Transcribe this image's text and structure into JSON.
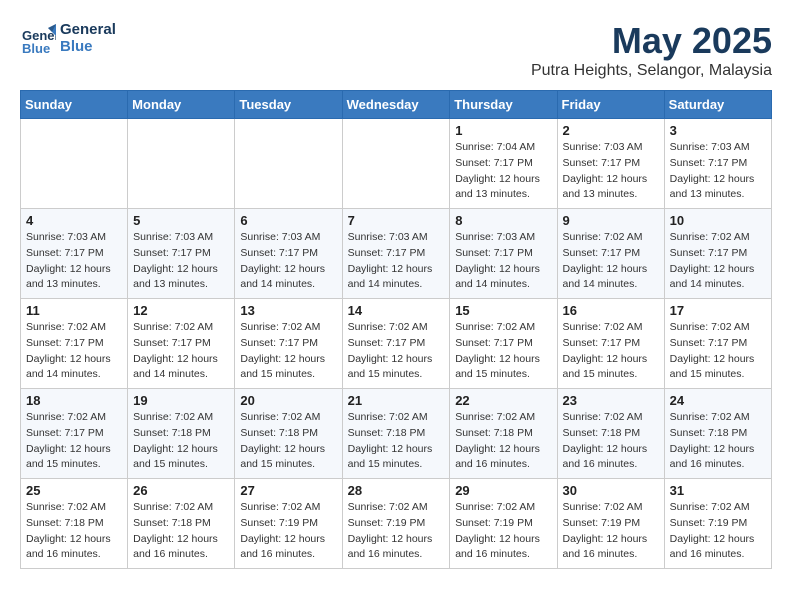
{
  "logo": {
    "line1": "General",
    "line2": "Blue"
  },
  "title": "May 2025",
  "subtitle": "Putra Heights, Selangor, Malaysia",
  "weekdays": [
    "Sunday",
    "Monday",
    "Tuesday",
    "Wednesday",
    "Thursday",
    "Friday",
    "Saturday"
  ],
  "weeks": [
    [
      {
        "day": "",
        "info": ""
      },
      {
        "day": "",
        "info": ""
      },
      {
        "day": "",
        "info": ""
      },
      {
        "day": "",
        "info": ""
      },
      {
        "day": "1",
        "info": "Sunrise: 7:04 AM\nSunset: 7:17 PM\nDaylight: 12 hours\nand 13 minutes."
      },
      {
        "day": "2",
        "info": "Sunrise: 7:03 AM\nSunset: 7:17 PM\nDaylight: 12 hours\nand 13 minutes."
      },
      {
        "day": "3",
        "info": "Sunrise: 7:03 AM\nSunset: 7:17 PM\nDaylight: 12 hours\nand 13 minutes."
      }
    ],
    [
      {
        "day": "4",
        "info": "Sunrise: 7:03 AM\nSunset: 7:17 PM\nDaylight: 12 hours\nand 13 minutes."
      },
      {
        "day": "5",
        "info": "Sunrise: 7:03 AM\nSunset: 7:17 PM\nDaylight: 12 hours\nand 13 minutes."
      },
      {
        "day": "6",
        "info": "Sunrise: 7:03 AM\nSunset: 7:17 PM\nDaylight: 12 hours\nand 14 minutes."
      },
      {
        "day": "7",
        "info": "Sunrise: 7:03 AM\nSunset: 7:17 PM\nDaylight: 12 hours\nand 14 minutes."
      },
      {
        "day": "8",
        "info": "Sunrise: 7:03 AM\nSunset: 7:17 PM\nDaylight: 12 hours\nand 14 minutes."
      },
      {
        "day": "9",
        "info": "Sunrise: 7:02 AM\nSunset: 7:17 PM\nDaylight: 12 hours\nand 14 minutes."
      },
      {
        "day": "10",
        "info": "Sunrise: 7:02 AM\nSunset: 7:17 PM\nDaylight: 12 hours\nand 14 minutes."
      }
    ],
    [
      {
        "day": "11",
        "info": "Sunrise: 7:02 AM\nSunset: 7:17 PM\nDaylight: 12 hours\nand 14 minutes."
      },
      {
        "day": "12",
        "info": "Sunrise: 7:02 AM\nSunset: 7:17 PM\nDaylight: 12 hours\nand 14 minutes."
      },
      {
        "day": "13",
        "info": "Sunrise: 7:02 AM\nSunset: 7:17 PM\nDaylight: 12 hours\nand 15 minutes."
      },
      {
        "day": "14",
        "info": "Sunrise: 7:02 AM\nSunset: 7:17 PM\nDaylight: 12 hours\nand 15 minutes."
      },
      {
        "day": "15",
        "info": "Sunrise: 7:02 AM\nSunset: 7:17 PM\nDaylight: 12 hours\nand 15 minutes."
      },
      {
        "day": "16",
        "info": "Sunrise: 7:02 AM\nSunset: 7:17 PM\nDaylight: 12 hours\nand 15 minutes."
      },
      {
        "day": "17",
        "info": "Sunrise: 7:02 AM\nSunset: 7:17 PM\nDaylight: 12 hours\nand 15 minutes."
      }
    ],
    [
      {
        "day": "18",
        "info": "Sunrise: 7:02 AM\nSunset: 7:17 PM\nDaylight: 12 hours\nand 15 minutes."
      },
      {
        "day": "19",
        "info": "Sunrise: 7:02 AM\nSunset: 7:18 PM\nDaylight: 12 hours\nand 15 minutes."
      },
      {
        "day": "20",
        "info": "Sunrise: 7:02 AM\nSunset: 7:18 PM\nDaylight: 12 hours\nand 15 minutes."
      },
      {
        "day": "21",
        "info": "Sunrise: 7:02 AM\nSunset: 7:18 PM\nDaylight: 12 hours\nand 15 minutes."
      },
      {
        "day": "22",
        "info": "Sunrise: 7:02 AM\nSunset: 7:18 PM\nDaylight: 12 hours\nand 16 minutes."
      },
      {
        "day": "23",
        "info": "Sunrise: 7:02 AM\nSunset: 7:18 PM\nDaylight: 12 hours\nand 16 minutes."
      },
      {
        "day": "24",
        "info": "Sunrise: 7:02 AM\nSunset: 7:18 PM\nDaylight: 12 hours\nand 16 minutes."
      }
    ],
    [
      {
        "day": "25",
        "info": "Sunrise: 7:02 AM\nSunset: 7:18 PM\nDaylight: 12 hours\nand 16 minutes."
      },
      {
        "day": "26",
        "info": "Sunrise: 7:02 AM\nSunset: 7:18 PM\nDaylight: 12 hours\nand 16 minutes."
      },
      {
        "day": "27",
        "info": "Sunrise: 7:02 AM\nSunset: 7:19 PM\nDaylight: 12 hours\nand 16 minutes."
      },
      {
        "day": "28",
        "info": "Sunrise: 7:02 AM\nSunset: 7:19 PM\nDaylight: 12 hours\nand 16 minutes."
      },
      {
        "day": "29",
        "info": "Sunrise: 7:02 AM\nSunset: 7:19 PM\nDaylight: 12 hours\nand 16 minutes."
      },
      {
        "day": "30",
        "info": "Sunrise: 7:02 AM\nSunset: 7:19 PM\nDaylight: 12 hours\nand 16 minutes."
      },
      {
        "day": "31",
        "info": "Sunrise: 7:02 AM\nSunset: 7:19 PM\nDaylight: 12 hours\nand 16 minutes."
      }
    ]
  ]
}
